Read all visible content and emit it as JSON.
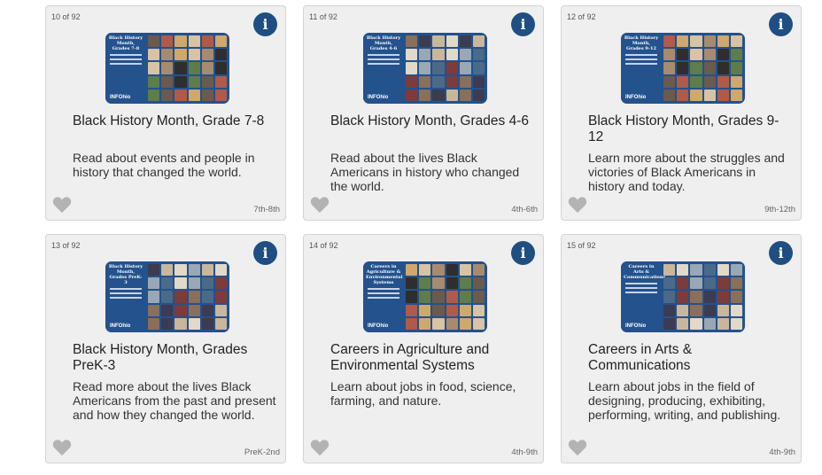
{
  "cards": [
    {
      "counter": "10 of 92",
      "title": "Black History Month, Grade 7-8",
      "description": "Read about events and people in history that changed the world.",
      "grade": "7th-8th",
      "thumb_title": "Black History Month, Grades 7-8",
      "thumb_logo": "INFOhio",
      "info_icon": "info-icon",
      "favorite_icon": "heart-icon"
    },
    {
      "counter": "11 of 92",
      "title": "Black History Month, Grades 4-6",
      "description": "Read about the lives Black Americans in history who changed the world.",
      "grade": "4th-6th",
      "thumb_title": "Black History Month, Grades 4-6",
      "thumb_logo": "INFOhio",
      "info_icon": "info-icon",
      "favorite_icon": "heart-icon"
    },
    {
      "counter": "12 of 92",
      "title": "Black History Month, Grades 9-12",
      "description": "Learn more about the struggles and victories of Black Americans in history and today.",
      "grade": "9th-12th",
      "thumb_title": "Black History Month, Grades 9-12",
      "thumb_logo": "INFOhio",
      "info_icon": "info-icon",
      "favorite_icon": "heart-icon"
    },
    {
      "counter": "13 of 92",
      "title": "Black History Month, Grades PreK-3",
      "description": "Read more about the lives Black Americans from the past and present and how they changed the world.",
      "grade": "PreK-2nd",
      "thumb_title": "Black History Month, Grades PreK-3",
      "thumb_logo": "INFOhio",
      "info_icon": "info-icon",
      "favorite_icon": "heart-icon"
    },
    {
      "counter": "14 of 92",
      "title": "Careers in Agriculture and Environmental Systems",
      "description": "Learn about jobs in food, science, farming, and nature.",
      "grade": "4th-9th",
      "thumb_title": "Careers in Agriculture & Environmental Systems",
      "thumb_logo": "INFOhio",
      "info_icon": "info-icon",
      "favorite_icon": "heart-icon"
    },
    {
      "counter": "15 of 92",
      "title": "Careers in Arts & Communications",
      "description": "Learn about jobs in the field of designing, producing, exhibiting, performing, writing, and publishing.",
      "grade": "4th-9th",
      "thumb_title": "Careers in Arts & Communications",
      "thumb_logo": "INFOhio",
      "info_icon": "info-icon",
      "favorite_icon": "heart-icon"
    }
  ],
  "colors": {
    "info_button": "#1f4e83",
    "card_bg": "#efefef",
    "heart": "#b3b3b3",
    "thumb_bg": "#23528c"
  }
}
